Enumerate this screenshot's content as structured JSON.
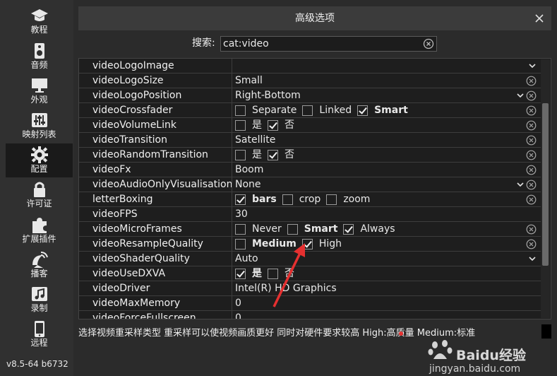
{
  "sidebar": {
    "items": [
      {
        "label": "教程",
        "icon": "graduation-cap-icon"
      },
      {
        "label": "音频",
        "icon": "speaker-icon"
      },
      {
        "label": "外观",
        "icon": "monitor-icon"
      },
      {
        "label": "映射列表",
        "icon": "sliders-icon"
      },
      {
        "label": "配置",
        "icon": "gear-icon",
        "active": true
      },
      {
        "label": "许可证",
        "icon": "lock-icon"
      },
      {
        "label": "扩展插件",
        "icon": "puzzle-icon"
      },
      {
        "label": "播客",
        "icon": "satellite-dish-icon"
      },
      {
        "label": "录制",
        "icon": "music-note-icon"
      },
      {
        "label": "远程",
        "icon": "phone-icon"
      }
    ],
    "version": "v8.5-64 b6732"
  },
  "dialog": {
    "title": "高级选项"
  },
  "search": {
    "label": "搜索:",
    "value": "cat:video"
  },
  "rows": [
    {
      "name": "videoLogoImage",
      "value": "",
      "dropdown": true
    },
    {
      "name": "videoLogoSize",
      "value": "Small",
      "clear": true
    },
    {
      "name": "videoLogoPosition",
      "value": "Right-Bottom",
      "dropdown": true,
      "clear": true
    },
    {
      "name": "videoCrossfader",
      "options": [
        {
          "label": "Separate",
          "checked": false
        },
        {
          "label": "Linked",
          "checked": false
        },
        {
          "label": "Smart",
          "checked": true,
          "bold": true
        }
      ],
      "clear": true
    },
    {
      "name": "videoVolumeLink",
      "options": [
        {
          "label": "是",
          "checked": false
        },
        {
          "label": "否",
          "checked": true
        }
      ],
      "clear": true
    },
    {
      "name": "videoTransition",
      "value": "Satellite",
      "clear": true
    },
    {
      "name": "videoRandomTransition",
      "options": [
        {
          "label": "是",
          "checked": false
        },
        {
          "label": "否",
          "checked": true
        }
      ],
      "clear": true
    },
    {
      "name": "videoFx",
      "value": "Boom",
      "clear": true
    },
    {
      "name": "videoAudioOnlyVisualisation",
      "value": "None",
      "dropdown": true,
      "clear": true
    },
    {
      "name": "letterBoxing",
      "options": [
        {
          "label": "bars",
          "checked": true,
          "bold": true
        },
        {
          "label": "crop",
          "checked": false
        },
        {
          "label": "zoom",
          "checked": false
        }
      ],
      "clear": true
    },
    {
      "name": "videoFPS",
      "value": "30"
    },
    {
      "name": "videoMicroFrames",
      "options": [
        {
          "label": "Never",
          "checked": false
        },
        {
          "label": "Smart",
          "checked": false,
          "bold": true
        },
        {
          "label": "Always",
          "checked": true
        }
      ],
      "clear": true
    },
    {
      "name": "videoResampleQuality",
      "options": [
        {
          "label": "Medium",
          "checked": false,
          "bold": true
        },
        {
          "label": "High",
          "checked": true
        }
      ],
      "clear": true
    },
    {
      "name": "videoShaderQuality",
      "value": "Auto",
      "dropdown": true
    },
    {
      "name": "videoUseDXVA",
      "options": [
        {
          "label": "是",
          "checked": true,
          "bold": true
        },
        {
          "label": "否",
          "checked": false
        }
      ]
    },
    {
      "name": "videoDriver",
      "value": "Intel(R) HD Graphics"
    },
    {
      "name": "videoMaxMemory",
      "value": "0"
    },
    {
      "name": "videoForceFullscreen",
      "value": "0"
    }
  ],
  "status": {
    "text": "选择视频重采样类型  重采样可以使视频画质更好  同时对硬件要求较高  High:高质量  Medium:标准"
  },
  "watermark": {
    "brand": "Baidu经验",
    "url": "jingyan.baidu.com"
  },
  "colors": {
    "background": "#2b2b2b",
    "grid": "#1e1e1e",
    "annotation": "#e53030"
  }
}
